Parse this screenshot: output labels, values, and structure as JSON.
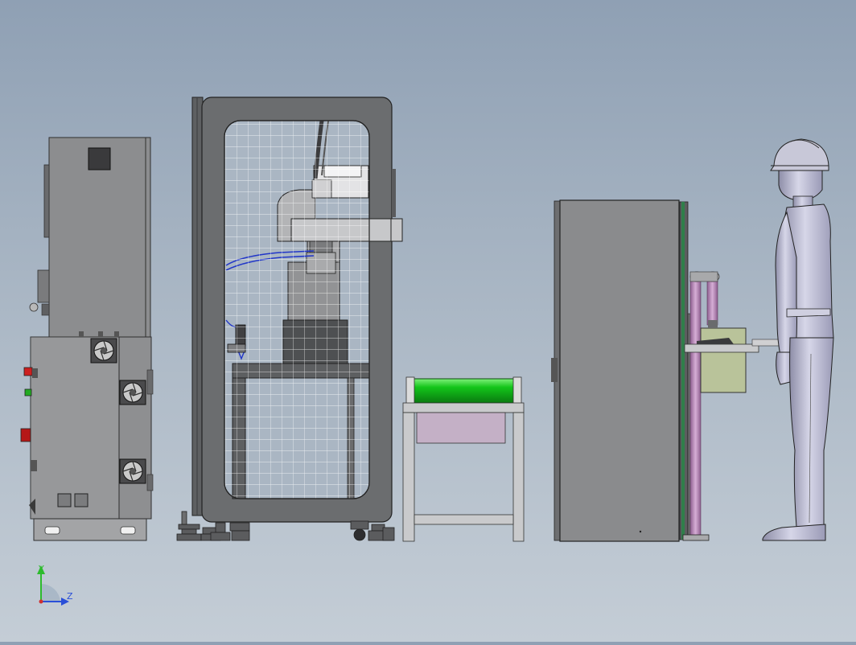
{
  "viewport": {
    "background_top": "#8fa0b4",
    "background_bottom": "#c4cdd6"
  },
  "axis_triad": {
    "y_label": "Y",
    "z_label": "Z",
    "y_color": "#2dbb2d",
    "z_color": "#2a4fd8",
    "origin_color": "#d03030"
  },
  "colors": {
    "cabinet_gray": "#8c8d8f",
    "frame_dark": "#5e6062",
    "conveyor_green": "#13c51a",
    "pipe_purple": "#b98aba",
    "panel_khaki": "#b9c39a",
    "mannequin": "#b9b9d3",
    "hose_blue": "#2136c8",
    "button_red": "#cc2020",
    "button_green": "#22aa22"
  },
  "components": [
    "electrical-cabinet",
    "robot-workcell",
    "conveyor-stand",
    "loading-station",
    "human-mannequin"
  ]
}
